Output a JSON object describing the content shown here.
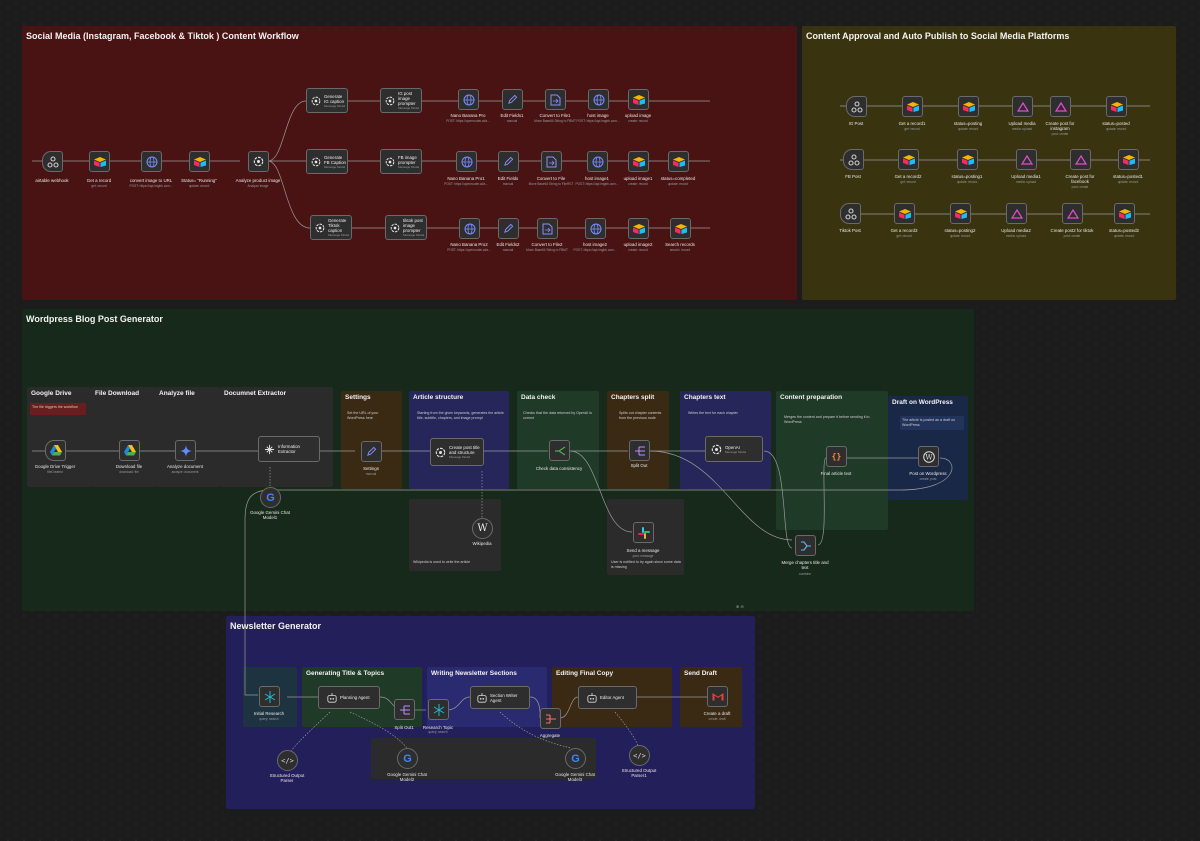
{
  "groups": {
    "social": "Social Media (Instagram, Facebook & Tiktok ) Content Workflow",
    "approval": "Content Approval and Auto Publish to Social Media Platforms",
    "wordpress": "Wordpress Blog Post Generator",
    "newsletter": "Newsletter Generator"
  },
  "social_nodes": {
    "webhook": {
      "label": "airtable webhook"
    },
    "get_record": {
      "label": "Get a record",
      "sub": "get: record"
    },
    "convert_url": {
      "label": "convert image to URL",
      "sub": "POST: https://api.imgbb.com..."
    },
    "status_running": {
      "label": "Status= \"Running\"",
      "sub": "update: record"
    },
    "analyze": {
      "label": "Analyze product image",
      "sub": "Analyze image"
    },
    "gen_ig": {
      "label": "Generate IG caption",
      "sub": "Message Model"
    },
    "ig_prompter": {
      "label": "IG post image prompter",
      "sub": "Message Model"
    },
    "nano1": {
      "label": "Nano Banana Pro",
      "sub": "POST: https://openrouter.ai/a..."
    },
    "edit1": {
      "label": "Edit Fields1",
      "sub": "manual"
    },
    "conv_file1": {
      "label": "Convert to File1",
      "sub": "Move Base64 String to FBMT"
    },
    "host_image": {
      "label": "host image",
      "sub": "POST: https://api.imgbb.com..."
    },
    "upload_image": {
      "label": "upload image",
      "sub": "create: record"
    },
    "gen_fb": {
      "label": "Generate FB Caption",
      "sub": "Message Model"
    },
    "fb_prompter": {
      "label": "FB image prompter",
      "sub": "Message Model"
    },
    "nano_pro1": {
      "label": "Nano Banana Pro1",
      "sub": "POST: https://openrouter.ai/a..."
    },
    "edit_fields": {
      "label": "Edit Fields",
      "sub": "manual"
    },
    "conv_file": {
      "label": "Convert to File",
      "sub": "Move Base64 String to FileRST"
    },
    "host_image1": {
      "label": "host image1",
      "sub": "POST: https://api.imgbb.com..."
    },
    "upload_image1": {
      "label": "upload image1",
      "sub": "create: record"
    },
    "status_completed": {
      "label": "status=completed",
      "sub": "update: record"
    },
    "gen_tiktok": {
      "label": "Generate Tiktok caption",
      "sub": "Message Model"
    },
    "tiktok_prompter": {
      "label": "tiktok post image prompter",
      "sub": "Message Model"
    },
    "nano2": {
      "label": "Nano Banana Pro2",
      "sub": "POST: https://openrouter.ai/a..."
    },
    "edit2": {
      "label": "Edit Fields2",
      "sub": "manual"
    },
    "conv_file2": {
      "label": "Convert to File2",
      "sub": "Move Base64 String to FBMT"
    },
    "host_image2": {
      "label": "host image2",
      "sub": "POST: https://api.imgbb.com..."
    },
    "upload_image2": {
      "label": "upload image2",
      "sub": "create: record"
    },
    "search_records": {
      "label": "Search records",
      "sub": "search: record"
    }
  },
  "approval_nodes": {
    "ig_post": {
      "label": "IG Post"
    },
    "get_record1": {
      "label": "Get a record1",
      "sub": "get: record"
    },
    "status_posting": {
      "label": "status=posting",
      "sub": "update: record"
    },
    "upload_media": {
      "label": "Upload media",
      "sub": "media: upload"
    },
    "create_post_ig": {
      "label": "Create post for instagram",
      "sub": "post: create"
    },
    "status_posted": {
      "label": "status=posted",
      "sub": "update: record"
    },
    "fb_post": {
      "label": "FB Post"
    },
    "get_record2": {
      "label": "Get a record2",
      "sub": "get: record"
    },
    "status_posting1": {
      "label": "status=posting1",
      "sub": "update: record"
    },
    "upload_media1": {
      "label": "Upload media1",
      "sub": "media: upload"
    },
    "create_post_fb": {
      "label": "Create post for facebook",
      "sub": "post: create"
    },
    "status_posted1": {
      "label": "status=posted1",
      "sub": "update: record"
    },
    "tiktok_post": {
      "label": "Tiktok Post"
    },
    "get_record3": {
      "label": "Get a record3",
      "sub": "get: record"
    },
    "status_posting2": {
      "label": "status=posting2",
      "sub": "update: record"
    },
    "upload_media2": {
      "label": "Upload media2",
      "sub": "media: upload"
    },
    "create_post2_tiktok": {
      "label": "Create post2 for tiktok",
      "sub": "post: create"
    },
    "status_posted2": {
      "label": "status=posted2",
      "sub": "update: record"
    }
  },
  "wp_sections": {
    "gdrive": "Google Drive",
    "file_download": "File Download",
    "analyze_file": "Analyze file",
    "doc_extractor": "Documnet Extractor",
    "settings": "Settings",
    "article_structure": "Article structure",
    "data_check": "Data check",
    "chapters_split": "Chapters split",
    "chapters_text": "Chapters text",
    "content_prep": "Content preparation",
    "draft_wp": "Draft on WordPress"
  },
  "wp_notes": {
    "gdrive": "The file triggers the workflow",
    "settings": "Set the URL of your WordPress here",
    "article_structure": "Starting from the given keywords, generates the article title, subtitle, chapters, and image prompt",
    "data_check": "Checks that the data returned by OpenAI is correct",
    "chapters_split": "Splits out chapter contents from the previous node",
    "chapters_text": "Writes the text for each chapter",
    "content_prep": "Merges the content and prepare it before sending it to WordPress",
    "draft_wp": "The article is posted as a draft on WordPress",
    "wikipedia": "Wikipedia is used to write the article",
    "slack": "User is notified to try again since some data is missing"
  },
  "wp_nodes": {
    "gdrive_trigger": {
      "label": "Google Drive Trigger",
      "sub": "fileCreated"
    },
    "download_file": {
      "label": "Download file",
      "sub": "download: file"
    },
    "analyze_doc": {
      "label": "Analyze document",
      "sub": "analyze: document"
    },
    "info_extractor": {
      "label": "Information Extractor"
    },
    "gemini1": {
      "label": "Google Gemini Chat Model1"
    },
    "settings": {
      "label": "Settings",
      "sub": "manual"
    },
    "create_title": {
      "label": "Create post title and structure",
      "sub": "Message Model"
    },
    "wikipedia": {
      "label": "Wikipedia"
    },
    "check_data": {
      "label": "Check data consistency"
    },
    "split_out": {
      "label": "Split Out"
    },
    "openai": {
      "label": "OpenAI",
      "sub": "Message Model"
    },
    "send_message": {
      "label": "Send a message",
      "sub": "post: message"
    },
    "merge_chapters": {
      "label": "Merge chapters title and text",
      "sub": "combine"
    },
    "final_article": {
      "label": "Final article text"
    },
    "post_wp": {
      "label": "Post on Wordpress",
      "sub": "create: post"
    }
  },
  "nl_sections": {
    "title_topics": "Generating Title & Topics",
    "writing": "Writing Newsletter Sections",
    "editing": "Editing Final Copy",
    "send_draft": "Send Draft"
  },
  "nl_nodes": {
    "initial_research": {
      "label": "Initial Research",
      "sub": "query: search"
    },
    "planning_agent": {
      "label": "Planning Agent"
    },
    "split_out1": {
      "label": "Split Out1"
    },
    "research_topic": {
      "label": "Research Topic",
      "sub": "query: search"
    },
    "section_writer": {
      "label": "Section Writer Agent"
    },
    "aggregate": {
      "label": "Aggregate"
    },
    "editor_agent": {
      "label": "Editor Agent"
    },
    "create_draft": {
      "label": "Create a draft",
      "sub": "create: draft"
    },
    "parser": {
      "label": "Structured Output Parser"
    },
    "gemini2": {
      "label": "Google Gemini Chat Model2"
    },
    "gemini3": {
      "label": "Google Gemini Chat Model3"
    },
    "parser1": {
      "label": "Structured Output Parser1"
    }
  },
  "colors": {
    "social_bg": "#4a1313",
    "approval_bg": "#3a3310",
    "wordpress_bg": "#17291b",
    "newsletter_bg": "#231f5a",
    "airtable": "#f5b400",
    "openai": "#e8e8e8",
    "gemini": "#4285f4"
  }
}
